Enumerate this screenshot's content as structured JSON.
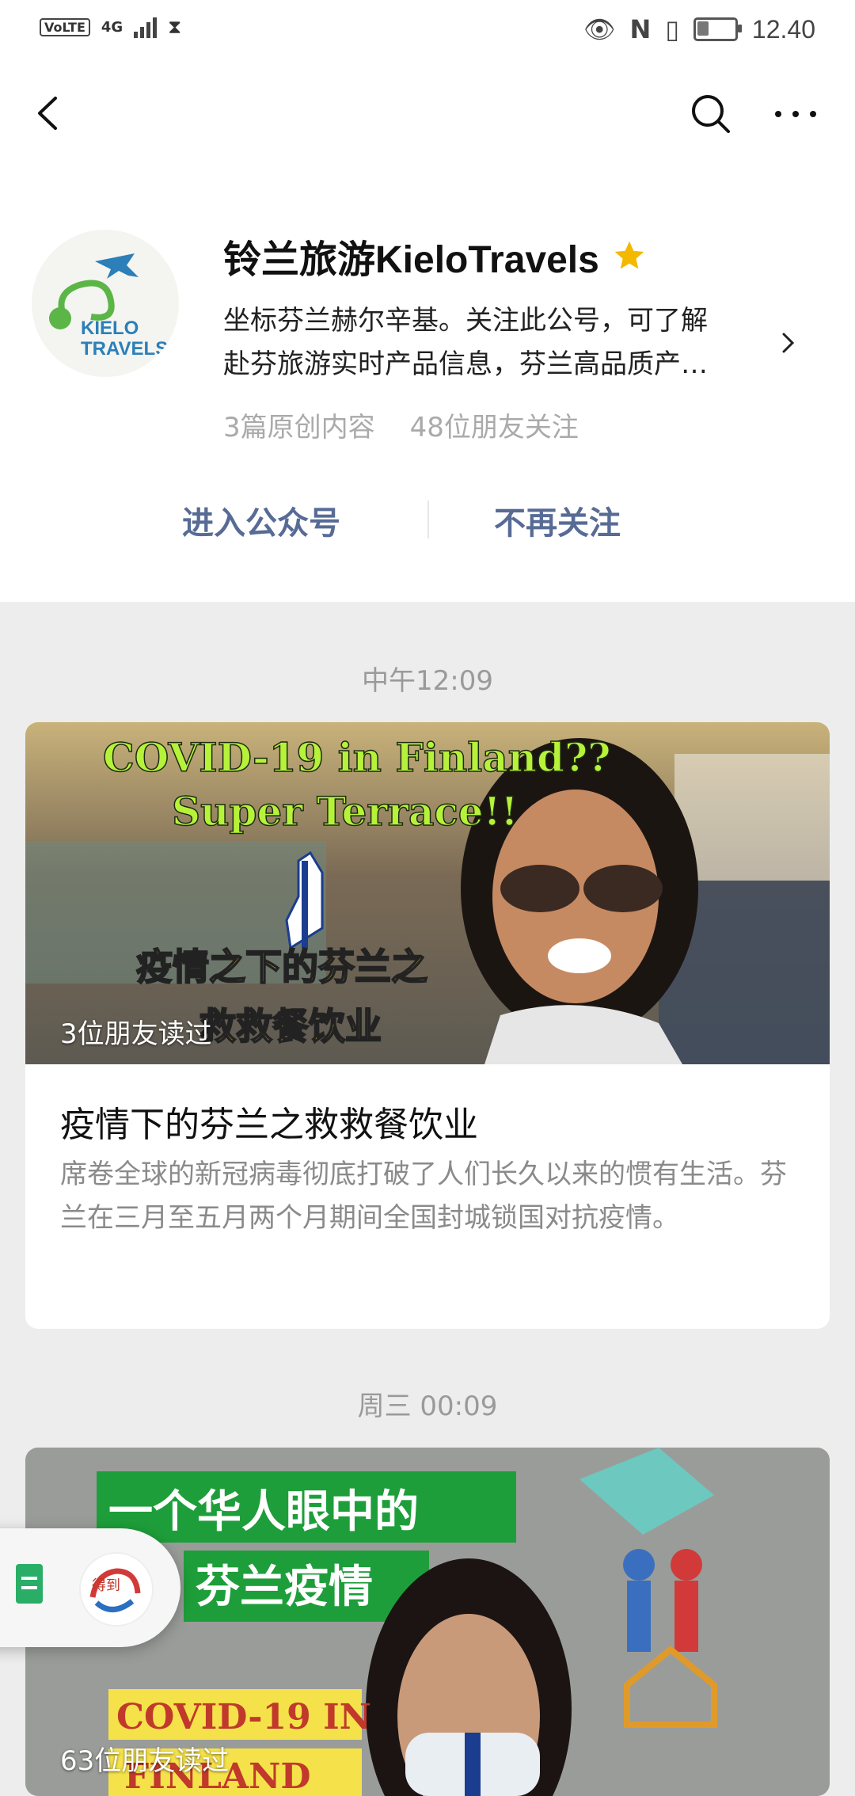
{
  "status_bar": {
    "volte": "VoLTE",
    "network": "4G",
    "time": "12.40",
    "battery_level": 0.35
  },
  "nav": {
    "back": "back-icon",
    "search": "search-icon",
    "more": "more-icon"
  },
  "account": {
    "name": "铃兰旅游KieloTravels",
    "logo_text": [
      "KIELO",
      "TRAVELS"
    ],
    "description_lines": [
      "坐标芬兰赫尔辛基。关注此公号，可了解",
      "赴芬旅游实时产品信息，芬兰高品质产…"
    ],
    "original_count": "3篇原创内容",
    "friends_following": "48位朋友关注"
  },
  "actions": {
    "enter": "进入公众号",
    "unfollow": "不再关注"
  },
  "feed": [
    {
      "time": "中午12:09",
      "cover_text": [
        "COVID-19 in Finland??",
        "Super Terrace!!",
        "疫情之下的芬兰之",
        "救救餐饮业"
      ],
      "readers": "3位朋友读过",
      "title": "疫情下的芬兰之救救餐饮业",
      "summary": "席卷全球的新冠病毒彻底打破了人们长久以来的惯有生活。芬兰在三月至五月两个月期间全国封城锁国对抗疫情。"
    },
    {
      "time": "周三 00:09",
      "cover_text": [
        "一个华人眼中的",
        "芬兰疫情",
        "COVID-19 IN",
        "FINLAND"
      ],
      "readers": "63位朋友读过"
    }
  ],
  "floating": {
    "app_label": "得到"
  },
  "colors": {
    "link": "#576b95",
    "star": "#f5b800",
    "bg": "#ededed"
  }
}
